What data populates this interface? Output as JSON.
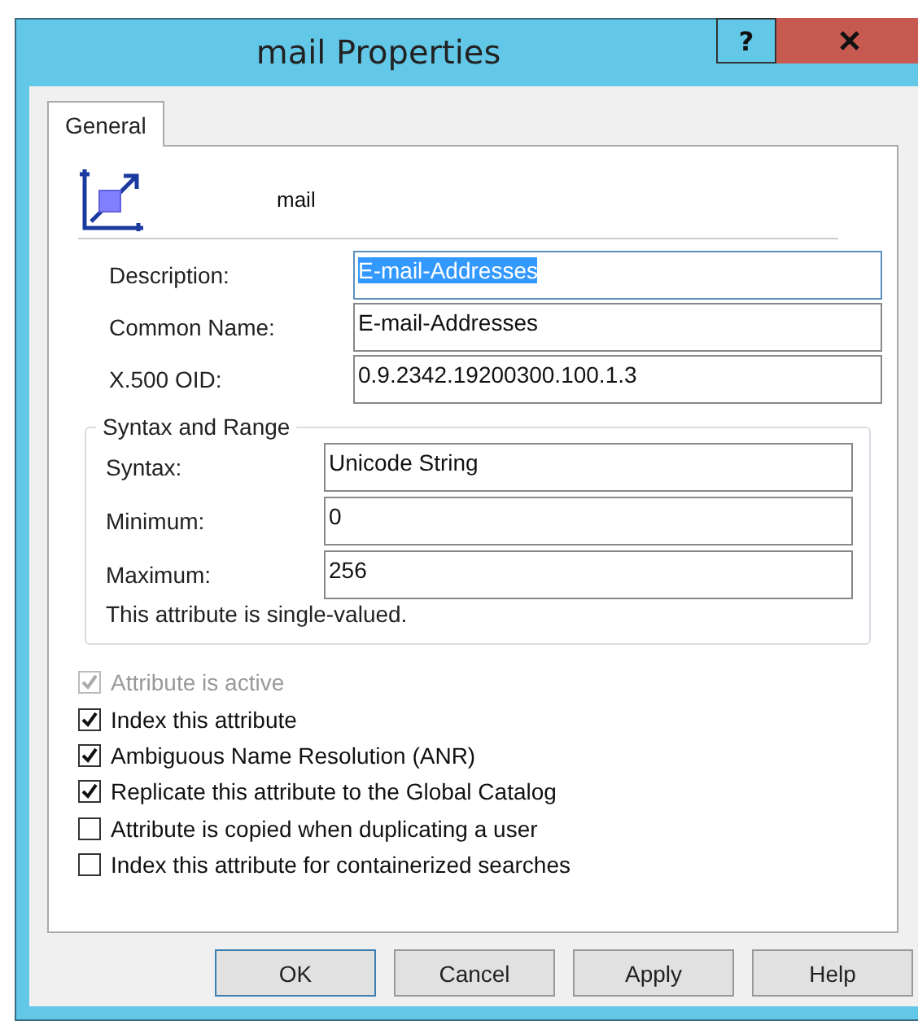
{
  "window": {
    "title": "mail Properties",
    "help_button": "?"
  },
  "tabs": [
    {
      "label": "General",
      "selected": true
    }
  ],
  "header": {
    "name": "mail"
  },
  "fields": [
    {
      "label": "Description:",
      "value": "E-mail-Addresses",
      "focused": true,
      "text_selected": true
    },
    {
      "label": "Common Name:",
      "value": "E-mail-Addresses",
      "focused": false,
      "text_selected": false
    },
    {
      "label": "X.500 OID:",
      "value": "0.9.2342.19200300.100.1.3",
      "focused": false,
      "text_selected": false
    }
  ],
  "syntax_and_range": {
    "title": "Syntax and Range",
    "fields": [
      {
        "label": "Syntax:",
        "value": "Unicode String"
      },
      {
        "label": "Minimum:",
        "value": "0"
      },
      {
        "label": "Maximum:",
        "value": "256"
      }
    ],
    "note": "This attribute is single-valued."
  },
  "checkboxes": [
    {
      "label": "Attribute is active",
      "checked": true,
      "disabled": true
    },
    {
      "label": "Index this attribute",
      "checked": true,
      "disabled": false
    },
    {
      "label": "Ambiguous Name Resolution (ANR)",
      "checked": true,
      "disabled": false
    },
    {
      "label": "Replicate this attribute to the Global Catalog",
      "checked": true,
      "disabled": false
    },
    {
      "label": "Attribute is copied when duplicating a user",
      "checked": false,
      "disabled": false
    },
    {
      "label": "Index this attribute for containerized searches",
      "checked": false,
      "disabled": false
    }
  ],
  "buttons": [
    {
      "label": "OK",
      "default": true
    },
    {
      "label": "Cancel",
      "default": false
    },
    {
      "label": "Apply",
      "default": false
    },
    {
      "label": "Help",
      "default": false
    }
  ]
}
